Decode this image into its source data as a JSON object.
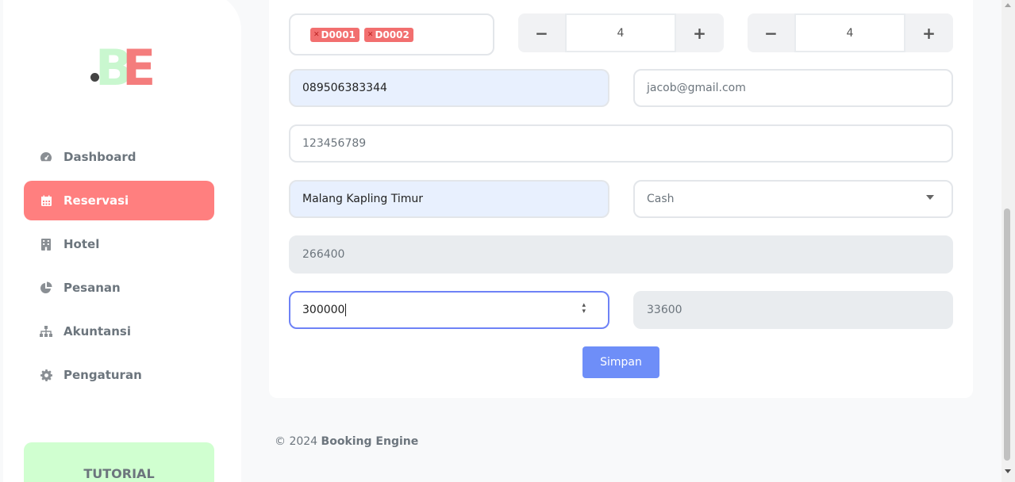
{
  "logo": {
    "letters": ".BE"
  },
  "sidebar": {
    "items": [
      {
        "label": "Dashboard",
        "icon": "dashboard-gauge-icon",
        "active": false
      },
      {
        "label": "Reservasi",
        "icon": "calendar-icon",
        "active": true
      },
      {
        "label": "Hotel",
        "icon": "building-icon",
        "active": false
      },
      {
        "label": "Pesanan",
        "icon": "pie-chart-icon",
        "active": false
      },
      {
        "label": "Akuntansi",
        "icon": "sitemap-icon",
        "active": false
      },
      {
        "label": "Pengaturan",
        "icon": "gear-icon",
        "active": false
      }
    ],
    "tutorial_label": "TUTORIAL"
  },
  "form": {
    "rooms": [
      "D0001",
      "D0002"
    ],
    "stepper1_value": "4",
    "stepper2_value": "4",
    "phone": "089506383344",
    "email": "jacob@gmail.com",
    "id_number": "123456789",
    "address": "Malang Kapling Timur",
    "payment_method": "Cash",
    "total": "266400",
    "paid": "300000",
    "change": "33600",
    "stepper_minus": "−",
    "stepper_plus": "+",
    "submit_label": "Simpan"
  },
  "footer": {
    "prefix": "© 2024 ",
    "brand": "Booking Engine"
  },
  "colors": {
    "accent": "#ff7f7f",
    "primary": "#6e8ef8",
    "tutorial_bg": "#d0ffd0"
  }
}
